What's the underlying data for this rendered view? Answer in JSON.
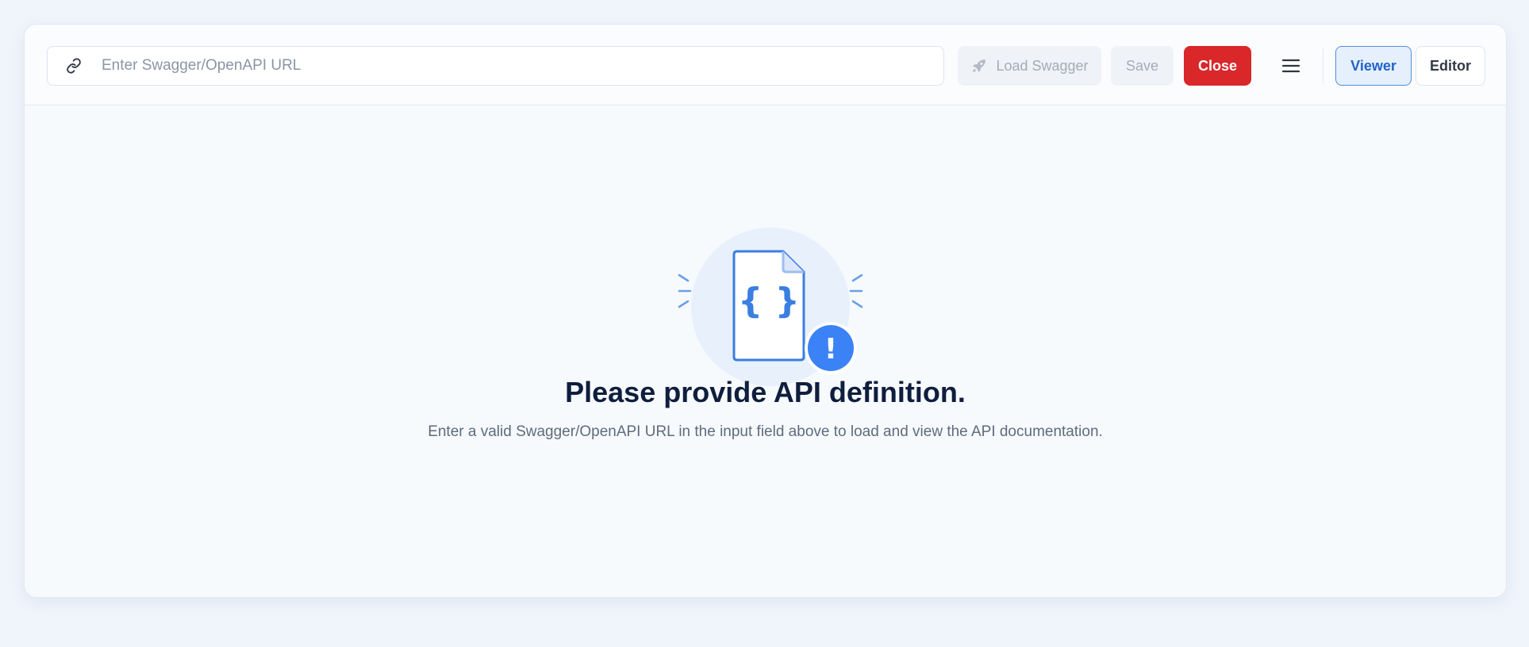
{
  "toolbar": {
    "url_placeholder": "Enter Swagger/OpenAPI URL",
    "url_value": "",
    "load_label": "Load Swagger",
    "save_label": "Save",
    "close_label": "Close",
    "viewer_label": "Viewer",
    "editor_label": "Editor",
    "active_mode": "Viewer"
  },
  "empty_state": {
    "title": "Please provide API definition.",
    "description": "Enter a valid Swagger/OpenAPI URL in the input field above to load and view the API documentation.",
    "braces_glyph": "{ }",
    "alert_glyph": "!"
  },
  "icons": {
    "url": "link-icon",
    "load": "rocket-icon",
    "menu": "hamburger-menu-icon",
    "illustration": "api-document-icon",
    "alert": "exclamation-icon"
  },
  "colors": {
    "accent": "#3b82f6",
    "close": "#d9272a",
    "title": "#0f1e3d"
  }
}
